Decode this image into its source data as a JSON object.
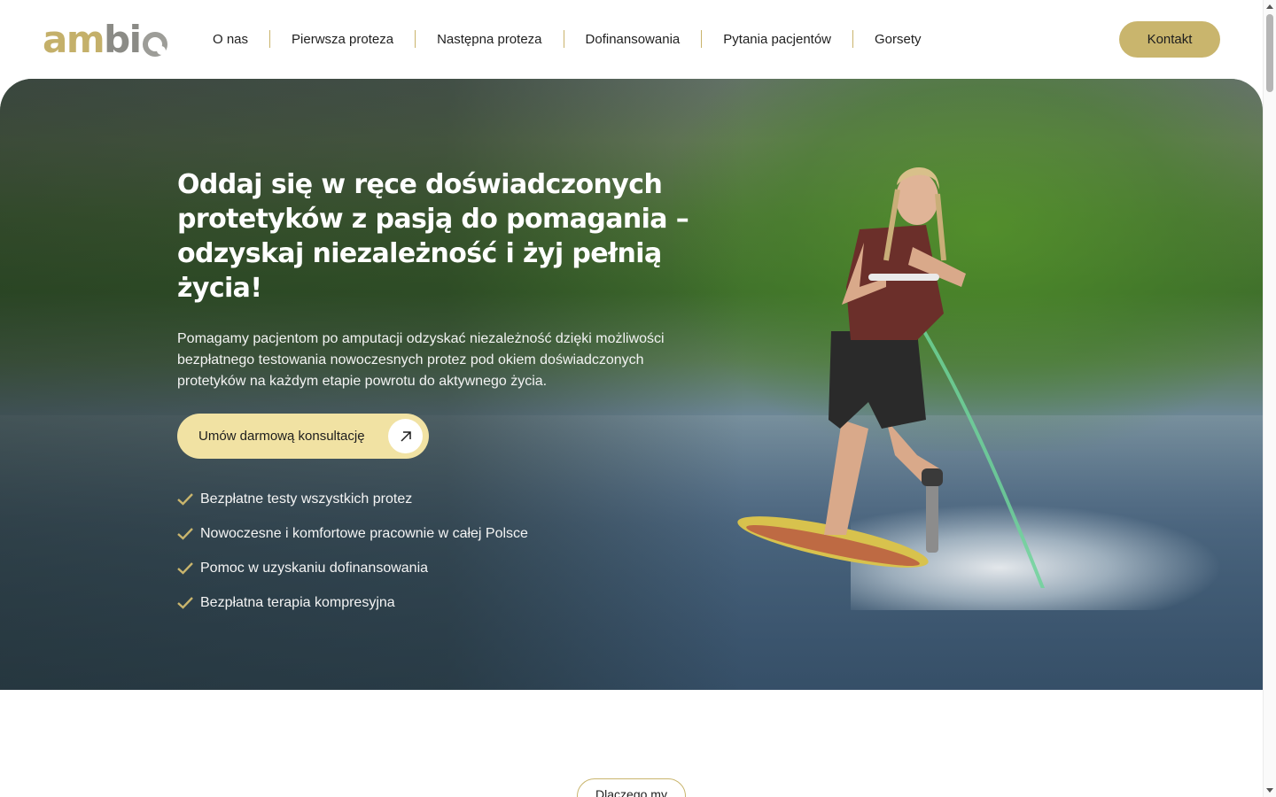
{
  "brand": {
    "logo_part1": "am",
    "logo_part2": "bi",
    "accent": "#c9b56d",
    "logo_gold": "#c4b06a",
    "logo_gray": "#8b8b86"
  },
  "nav": {
    "items": [
      {
        "label": "O nas"
      },
      {
        "label": "Pierwsza proteza"
      },
      {
        "label": "Następna proteza"
      },
      {
        "label": "Dofinansowania"
      },
      {
        "label": "Pytania pacjentów"
      },
      {
        "label": "Gorsety"
      }
    ],
    "contact_label": "Kontakt"
  },
  "hero": {
    "title": "Oddaj się w ręce doświadczonych protetyków z pasją do pomagania – odzyskaj niezależność i żyj pełnią życia!",
    "text": "Pomagamy pacjentom po amputacji odzyskać niezależność dzięki możliwości bezpłatnego testowania nowoczesnych protez pod okiem doświadczonych protetyków na każdym etapie powrotu do aktywnego życia.",
    "cta_label": "Umów darmową konsultację",
    "cta_icon": "arrow-up-right-icon",
    "features": [
      {
        "label": "Bezpłatne testy wszystkich protez"
      },
      {
        "label": "Nowoczesne i komfortowe pracownie w całej Polsce"
      },
      {
        "label": "Pomoc w uzyskaniu dofinansowania"
      },
      {
        "label": "Bezpłatna terapia kompresyjna"
      }
    ],
    "check_icon": "checkmark-icon",
    "check_color": "#c9b56d",
    "cta_color": "#f1e2a3"
  },
  "section": {
    "pill_label": "Dlaczego my"
  }
}
